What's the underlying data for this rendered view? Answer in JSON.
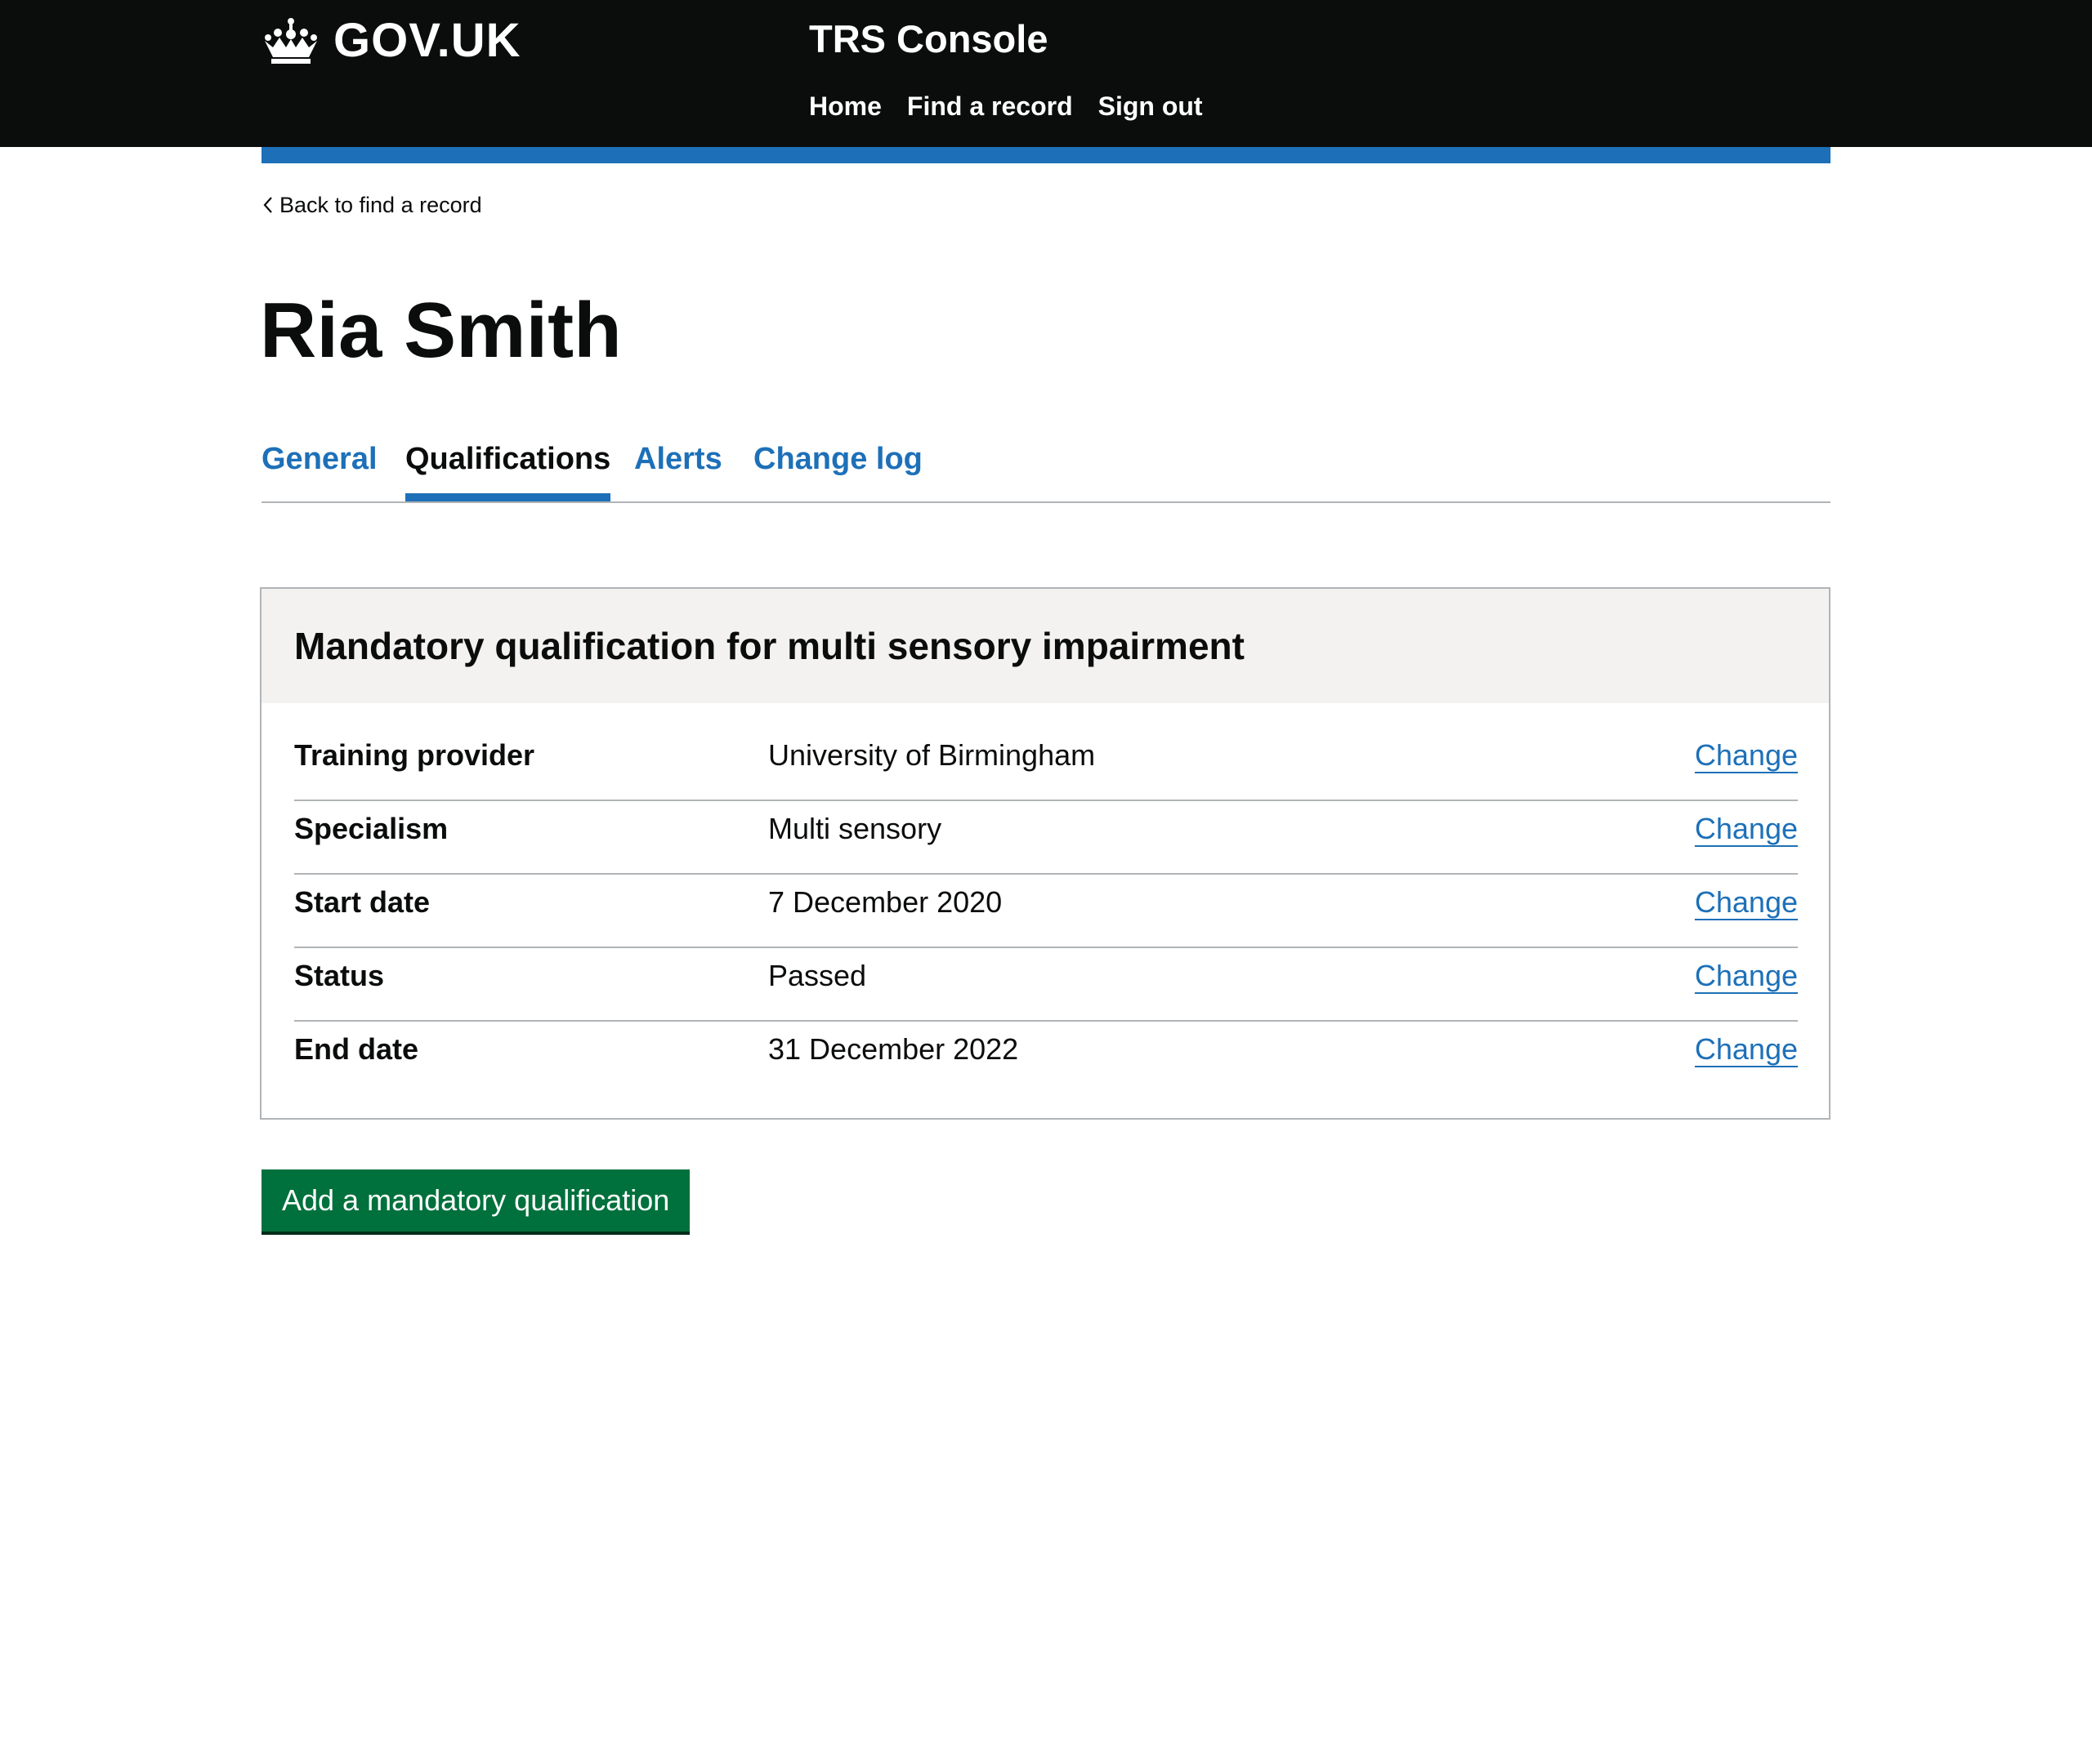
{
  "header": {
    "logo_text": "GOV.UK",
    "service_name": "TRS Console",
    "nav": [
      {
        "label": "Home"
      },
      {
        "label": "Find a record"
      },
      {
        "label": "Sign out"
      }
    ]
  },
  "back_link": "Back to find a record",
  "page_title": "Ria Smith",
  "tabs": [
    {
      "label": "General",
      "active": false
    },
    {
      "label": "Qualifications",
      "active": true
    },
    {
      "label": "Alerts",
      "active": false
    },
    {
      "label": "Change log",
      "active": false
    }
  ],
  "qualification_card": {
    "title": "Mandatory qualification for multi sensory impairment",
    "rows": [
      {
        "key": "Training provider",
        "value": "University of Birmingham",
        "action": "Change"
      },
      {
        "key": "Specialism",
        "value": "Multi sensory",
        "action": "Change"
      },
      {
        "key": "Start date",
        "value": "7 December 2020",
        "action": "Change"
      },
      {
        "key": "Status",
        "value": "Passed",
        "action": "Change"
      },
      {
        "key": "End date",
        "value": "31 December 2022",
        "action": "Change"
      }
    ]
  },
  "add_button_label": "Add a mandatory qualification",
  "colors": {
    "header_bg": "#0b0c0c",
    "brand_blue": "#1d70b8",
    "link_blue": "#1d70b8",
    "button_green": "#00703c",
    "card_header_bg": "#f3f2f1",
    "border_grey": "#b1b4b6"
  },
  "icons": {
    "logo": "crown-icon",
    "back": "chevron-left-icon"
  }
}
